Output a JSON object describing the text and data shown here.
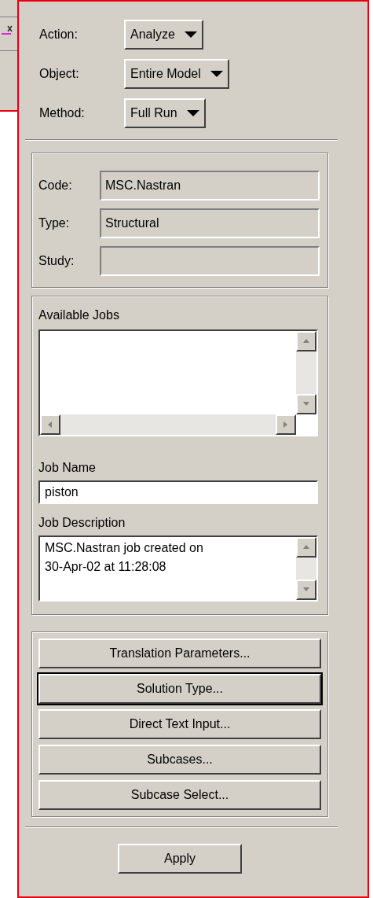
{
  "selectors": [
    {
      "label": "Action:",
      "value": "Analyze"
    },
    {
      "label": "Object:",
      "value": "Entire Model"
    },
    {
      "label": "Method:",
      "value": "Full Run"
    }
  ],
  "info_fields": [
    {
      "label": "Code:",
      "value": "MSC.Nastran"
    },
    {
      "label": "Type:",
      "value": "Structural"
    },
    {
      "label": "Study:"
    }
  ],
  "available_jobs": {
    "label": "Available Jobs"
  },
  "job_name": {
    "label": "Job Name",
    "value": "piston"
  },
  "job_description": {
    "label": "Job Description",
    "lines": [
      "MSC.Nastran job created on",
      "30-Apr-02 at 11:28:08"
    ]
  },
  "buttons": [
    {
      "label": "Translation Parameters...",
      "focused": false
    },
    {
      "label": "Solution Type...",
      "focused": true
    },
    {
      "label": "Direct Text Input...",
      "focused": false
    },
    {
      "label": "Subcases...",
      "focused": false
    },
    {
      "label": "Subcase Select...",
      "focused": false
    }
  ],
  "apply": "Apply"
}
